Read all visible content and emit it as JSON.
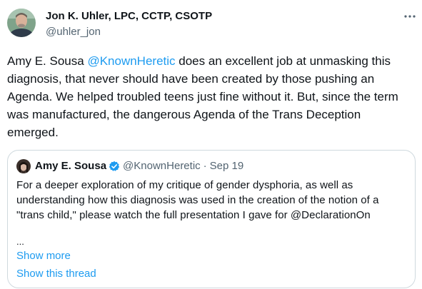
{
  "tweet": {
    "author_name": "Jon K. Uhler, LPC, CCTP, CSOTP",
    "author_handle": "@uhler_jon",
    "more_icon": "more-horizontal-icon",
    "text_before_mention": "Amy E. Sousa ",
    "mention": "@KnownHeretic",
    "text_after_mention": " does an excellent job at unmasking this diagnosis, that never should have been created by those pushing an Agenda. We helped troubled teens just fine without it. But, since the term was manufactured, the dangerous Agenda of the Trans Deception emerged."
  },
  "quote": {
    "author_name": "Amy E. Sousa",
    "verified_icon": "verified-badge-icon",
    "author_handle": "@KnownHeretic",
    "separator": "·",
    "date": "Sep 19",
    "text": "For a deeper exploration of my critique of gender dysphoria, as well as understanding how this diagnosis was used in the creation of the notion of a \"trans child,\" please watch the full presentation I gave for @DeclarationOn",
    "ellipsis": "...",
    "show_more": "Show more",
    "show_thread": "Show this thread"
  },
  "colors": {
    "link": "#1d9bf0",
    "secondary_text": "#536471",
    "border": "#cfd9de",
    "verified": "#1d9bf0"
  }
}
